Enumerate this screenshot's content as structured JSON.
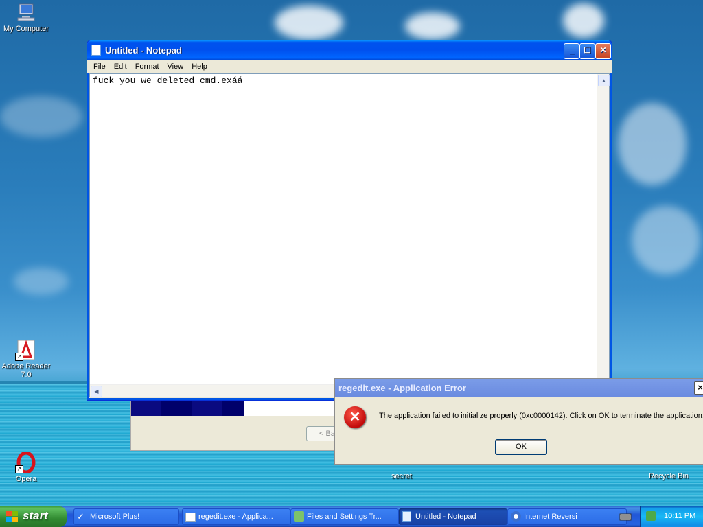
{
  "desktop": {
    "icons": [
      {
        "label": "My Computer"
      },
      {
        "label": "Adobe Reader 7.0"
      },
      {
        "label": "Opera"
      },
      {
        "label": "secret"
      },
      {
        "label": "Recycle Bin"
      }
    ]
  },
  "notepad": {
    "title": "Untitled - Notepad",
    "menu": [
      "File",
      "Edit",
      "Format",
      "View",
      "Help"
    ],
    "content": "fuck you we deleted cmd.exáá"
  },
  "background_window": {
    "back_label": "< Ba"
  },
  "error_dialog": {
    "title": "regedit.exe - Application Error",
    "close_label": "×",
    "message": "The application failed to initialize properly (0xc0000142). Click on OK to terminate the application.",
    "ok_label": "OK",
    "icon": "error-icon"
  },
  "taskbar": {
    "start_label": "start",
    "tasks": [
      {
        "label": "Microsoft Plus!",
        "icon": "plus-icon"
      },
      {
        "label": "regedit.exe - Applica...",
        "icon": "window-icon"
      },
      {
        "label": "Files and Settings Tr...",
        "icon": "transfer-icon"
      },
      {
        "label": "Untitled - Notepad",
        "icon": "notepad-icon"
      },
      {
        "label": "Internet Reversi",
        "icon": "reversi-icon"
      }
    ],
    "clock": "10:11 PM"
  },
  "colors": {
    "titlebar_blue": "#0053ee",
    "start_green": "#3c9a3c",
    "error_red": "#c10a0a"
  }
}
